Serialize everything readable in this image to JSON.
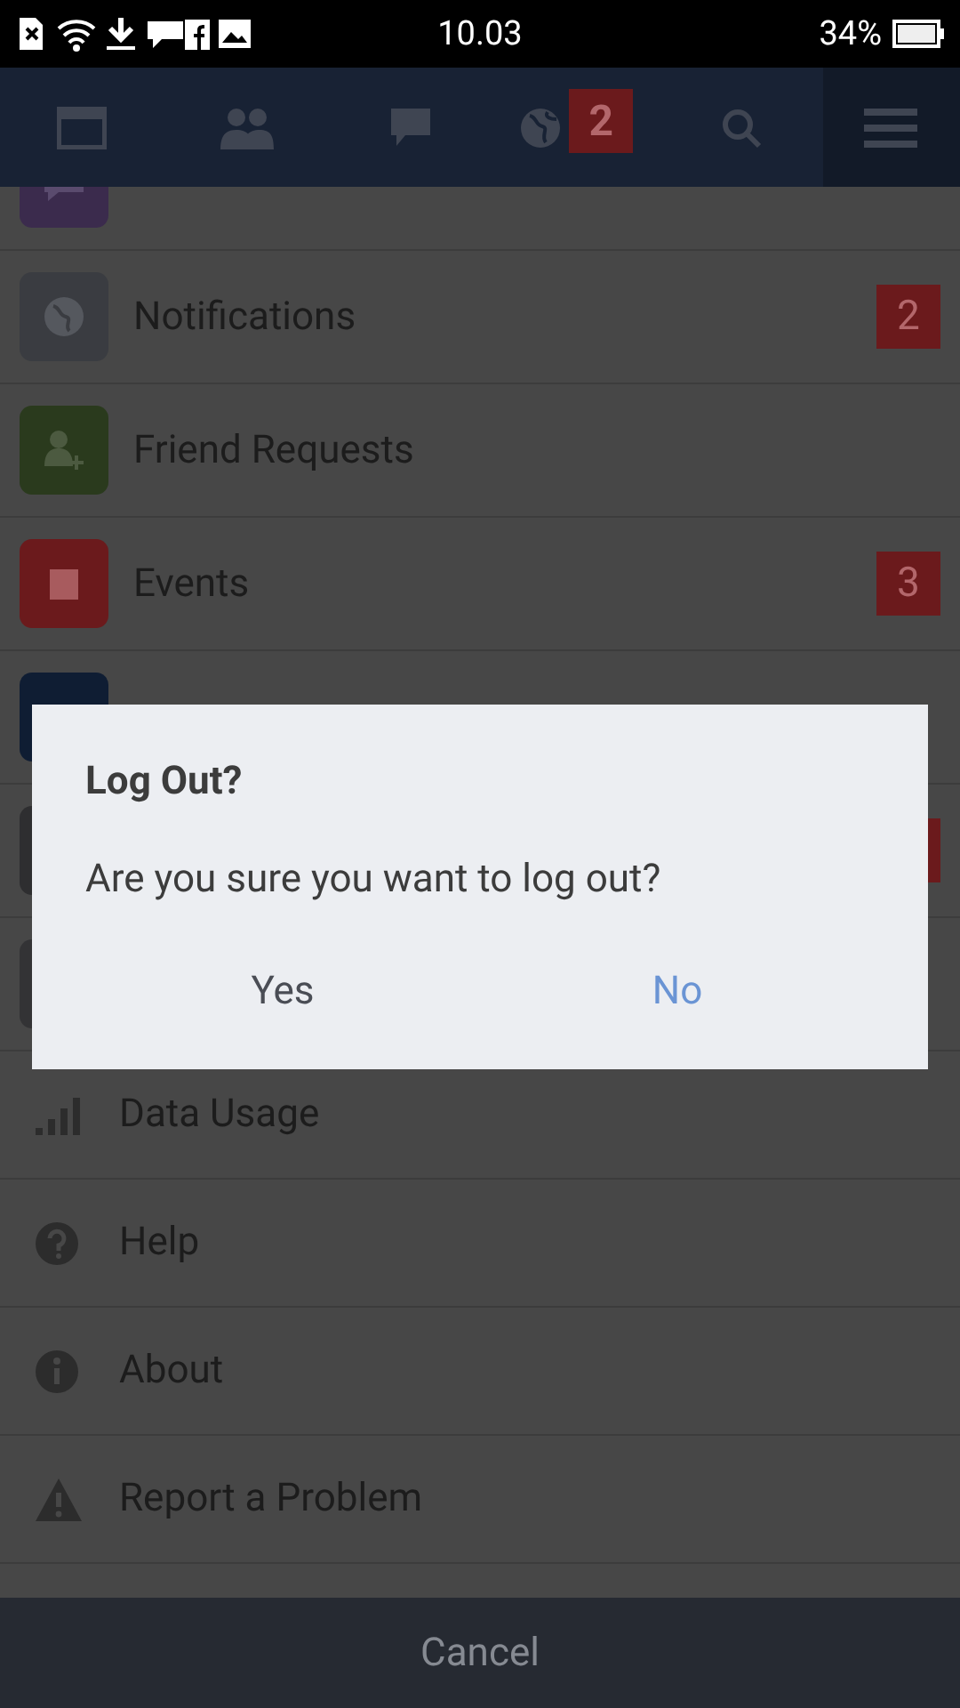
{
  "status_bar": {
    "time": "10.03",
    "battery": "34%"
  },
  "tabs": [
    {
      "selected": false
    },
    {
      "selected": false
    },
    {
      "selected": false
    },
    {
      "selected": false,
      "badge": "2"
    },
    {
      "selected": false
    },
    {
      "selected": true
    }
  ],
  "menu_items": [
    {
      "kind": "tile",
      "color": "#3b2b4d"
    },
    {
      "kind": "tile",
      "label": "Notifications",
      "color": "#3a3c41",
      "badge": "2"
    },
    {
      "kind": "tile",
      "label": "Friend Requests",
      "color": "#2a3a1d"
    },
    {
      "kind": "tile",
      "label": "Events",
      "color": "#6b1a1c",
      "badge": "3"
    },
    {
      "kind": "tile",
      "color": "#0f1d33"
    },
    {
      "kind": "tile",
      "color": "#2e2e30",
      "badge_covered": true
    },
    {
      "kind": "tile",
      "color": "#333335"
    },
    {
      "kind": "plain",
      "label": "Data Usage"
    },
    {
      "kind": "plain",
      "label": "Help"
    },
    {
      "kind": "plain",
      "label": "About"
    },
    {
      "kind": "plain",
      "label": "Report a Problem"
    }
  ],
  "dialog": {
    "title": "Log Out?",
    "message": "Are you sure you want to log out?",
    "buttons": [
      {
        "label": "Yes",
        "kind": "neutral"
      },
      {
        "label": "No",
        "kind": "accent"
      }
    ]
  },
  "cancel_button": "Cancel"
}
